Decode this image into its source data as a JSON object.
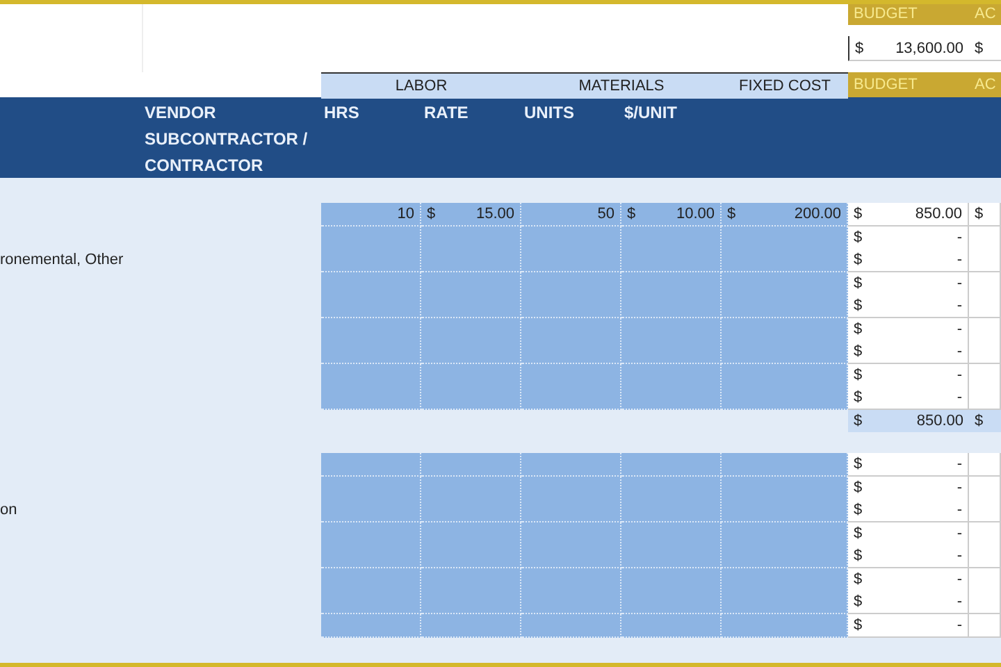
{
  "summary": {
    "budget_label": "BUDGET",
    "actual_label": "AC",
    "budget": {
      "sign": "$",
      "amount": "13,600.00"
    },
    "actual": {
      "sign": "$"
    }
  },
  "group_headers": [
    {
      "label": "LABOR",
      "kind": "span"
    },
    {
      "label": "MATERIALS",
      "kind": "span"
    },
    {
      "label": "FIXED COST",
      "kind": "plain"
    },
    {
      "label": "BUDGET",
      "kind": "gold"
    },
    {
      "label": "AC",
      "kind": "gold"
    }
  ],
  "columns": [
    "VENDOR SUBCONTRACTOR / CONTRACTOR",
    "HRS",
    "RATE",
    "UNITS",
    "$/UNIT"
  ],
  "sections": [
    {
      "rows": [
        {
          "hrs": "10",
          "rate": {
            "sign": "$",
            "amount": "15.00"
          },
          "units": "50",
          "unit_cost": {
            "sign": "$",
            "amount": "10.00"
          },
          "fixed_cost": {
            "sign": "$",
            "amount": "200.00"
          },
          "budget": {
            "sign": "$",
            "amount": "850.00"
          },
          "actual": {
            "sign": "$"
          }
        },
        {
          "budget": {
            "sign": "$",
            "amount": "-"
          }
        },
        {
          "task": "ronemental, Other",
          "budget": {
            "sign": "$",
            "amount": "-"
          }
        },
        {
          "budget": {
            "sign": "$",
            "amount": "-"
          }
        },
        {
          "budget": {
            "sign": "$",
            "amount": "-"
          }
        },
        {
          "budget": {
            "sign": "$",
            "amount": "-"
          }
        },
        {
          "budget": {
            "sign": "$",
            "amount": "-"
          }
        },
        {
          "budget": {
            "sign": "$",
            "amount": "-"
          }
        },
        {
          "budget": {
            "sign": "$",
            "amount": "-"
          }
        }
      ],
      "total": {
        "budget": {
          "sign": "$",
          "amount": "850.00"
        },
        "actual": {
          "sign": "$"
        }
      }
    },
    {
      "rows": [
        {
          "budget": {
            "sign": "$",
            "amount": "-"
          }
        },
        {
          "budget": {
            "sign": "$",
            "amount": "-"
          }
        },
        {
          "task": "on",
          "budget": {
            "sign": "$",
            "amount": "-"
          }
        },
        {
          "budget": {
            "sign": "$",
            "amount": "-"
          }
        },
        {
          "budget": {
            "sign": "$",
            "amount": "-"
          }
        },
        {
          "budget": {
            "sign": "$",
            "amount": "-"
          }
        },
        {
          "budget": {
            "sign": "$",
            "amount": "-"
          }
        },
        {
          "budget": {
            "sign": "$",
            "amount": "-"
          }
        }
      ]
    }
  ]
}
